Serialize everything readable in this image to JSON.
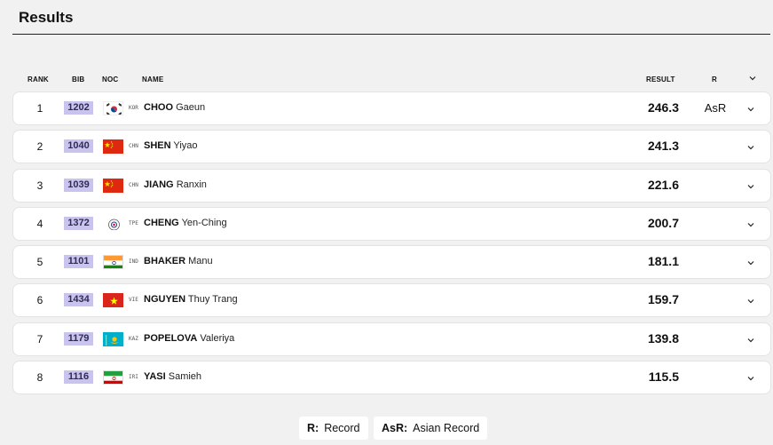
{
  "page": {
    "title": "Results"
  },
  "columns": {
    "rank": "RANK",
    "bib": "BIB",
    "noc": "NOC",
    "name": "NAME",
    "result": "RESULT",
    "record": "R"
  },
  "rows": [
    {
      "rank": "1",
      "bib": "1202",
      "noc": "KOR",
      "surname": "CHOO",
      "given": "Gaeun",
      "result": "246.3",
      "record": "AsR",
      "flag": "kor-flag-icon"
    },
    {
      "rank": "2",
      "bib": "1040",
      "noc": "CHN",
      "surname": "SHEN",
      "given": "Yiyao",
      "result": "241.3",
      "record": "",
      "flag": "chn-flag-icon"
    },
    {
      "rank": "3",
      "bib": "1039",
      "noc": "CHN",
      "surname": "JIANG",
      "given": "Ranxin",
      "result": "221.6",
      "record": "",
      "flag": "chn-flag-icon"
    },
    {
      "rank": "4",
      "bib": "1372",
      "noc": "TPE",
      "surname": "CHENG",
      "given": "Yen-Ching",
      "result": "200.7",
      "record": "",
      "flag": "tpe-flag-icon"
    },
    {
      "rank": "5",
      "bib": "1101",
      "noc": "IND",
      "surname": "BHAKER",
      "given": "Manu",
      "result": "181.1",
      "record": "",
      "flag": "ind-flag-icon"
    },
    {
      "rank": "6",
      "bib": "1434",
      "noc": "VIE",
      "surname": "NGUYEN",
      "given": "Thuy Trang",
      "result": "159.7",
      "record": "",
      "flag": "vie-flag-icon"
    },
    {
      "rank": "7",
      "bib": "1179",
      "noc": "KAZ",
      "surname": "POPELOVA",
      "given": "Valeriya",
      "result": "139.8",
      "record": "",
      "flag": "kaz-flag-icon"
    },
    {
      "rank": "8",
      "bib": "1116",
      "noc": "IRI",
      "surname": "YASI",
      "given": "Samieh",
      "result": "115.5",
      "record": "",
      "flag": "iri-flag-icon"
    }
  ],
  "legend": [
    {
      "key": "R:",
      "label": "Record"
    },
    {
      "key": "AsR:",
      "label": "Asian Record"
    }
  ],
  "colors": {
    "bib_bg": "#c9c4ee",
    "page_bg": "#f1f1f1"
  }
}
